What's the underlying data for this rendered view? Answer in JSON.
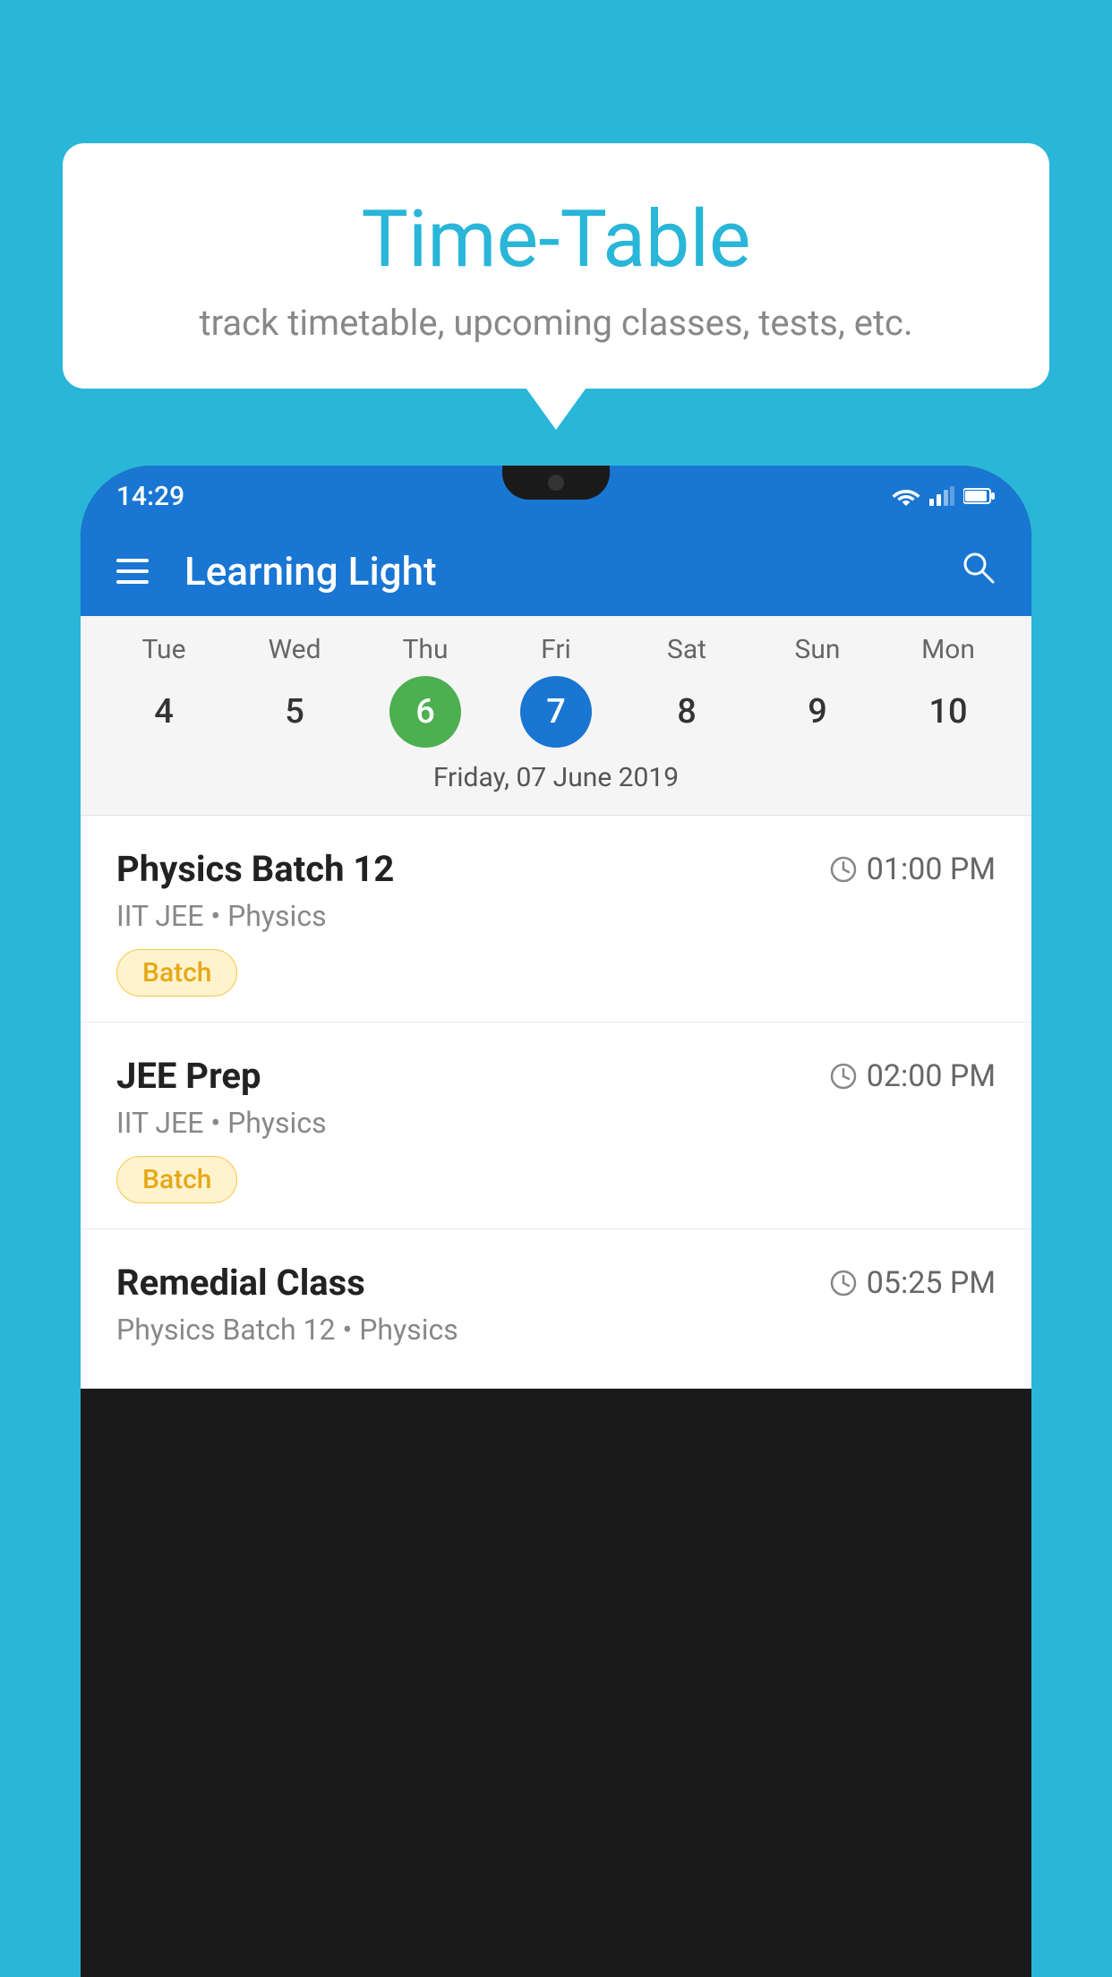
{
  "page": {
    "background_color": "#29B6D8"
  },
  "bubble": {
    "title": "Time-Table",
    "subtitle": "track timetable, upcoming classes, tests, etc."
  },
  "status_bar": {
    "time": "14:29"
  },
  "app_bar": {
    "title": "Learning Light",
    "hamburger_label": "menu",
    "search_label": "search"
  },
  "calendar": {
    "days": [
      {
        "name": "Tue",
        "number": "4",
        "state": "normal"
      },
      {
        "name": "Wed",
        "number": "5",
        "state": "normal"
      },
      {
        "name": "Thu",
        "number": "6",
        "state": "today"
      },
      {
        "name": "Fri",
        "number": "7",
        "state": "selected"
      },
      {
        "name": "Sat",
        "number": "8",
        "state": "normal"
      },
      {
        "name": "Sun",
        "number": "9",
        "state": "normal"
      },
      {
        "name": "Mon",
        "number": "10",
        "state": "normal"
      }
    ],
    "selected_date_label": "Friday, 07 June 2019"
  },
  "schedule": {
    "items": [
      {
        "title": "Physics Batch 12",
        "time": "01:00 PM",
        "meta": "IIT JEE • Physics",
        "badge": "Batch"
      },
      {
        "title": "JEE Prep",
        "time": "02:00 PM",
        "meta": "IIT JEE • Physics",
        "badge": "Batch"
      },
      {
        "title": "Remedial Class",
        "time": "05:25 PM",
        "meta": "Physics Batch 12 • Physics",
        "badge": null
      }
    ]
  }
}
